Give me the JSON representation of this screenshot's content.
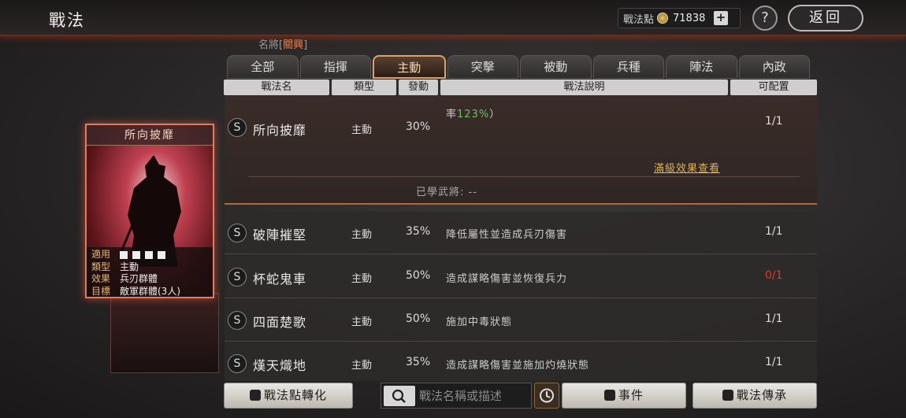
{
  "header": {
    "title": "戰法",
    "points_label": "戰法點",
    "points_value": "71838",
    "plus": "+",
    "help": "?",
    "back": "返回"
  },
  "general_label": {
    "prefix": "名將[",
    "name": "關興",
    "suffix": "]"
  },
  "tabs": [
    "全部",
    "指揮",
    "主動",
    "突擊",
    "被動",
    "兵種",
    "陣法",
    "內政"
  ],
  "active_tab": "主動",
  "columns": {
    "name": "戰法名",
    "type": "類型",
    "trigger": "發動",
    "desc": "戰法說明",
    "config": "可配置"
  },
  "expanded": {
    "badge": "S",
    "name": "所向披靡",
    "type": "主動",
    "rate": "30%",
    "desc_prefix": "率",
    "desc_pct": "123%",
    "desc_suffix": "）",
    "config": "1/1",
    "full_effect": "滿級效果查看",
    "learned": "已學武將: --"
  },
  "rows": [
    {
      "badge": "S",
      "name": "破陣摧堅",
      "type": "主動",
      "rate": "35%",
      "desc": "降低屬性並造成兵刃傷害",
      "config": "1/1",
      "config_color": "normal"
    },
    {
      "badge": "S",
      "name": "杯蛇鬼車",
      "type": "主動",
      "rate": "50%",
      "desc": "造成謀略傷害並恢復兵力",
      "config": "0/1",
      "config_color": "red"
    },
    {
      "badge": "S",
      "name": "四面楚歌",
      "type": "主動",
      "rate": "50%",
      "desc": "施加中毒狀態",
      "config": "1/1",
      "config_color": "normal"
    },
    {
      "badge": "S",
      "name": "熯天熾地",
      "type": "主動",
      "rate": "35%",
      "desc": "造成謀略傷害並施加灼燒狀態",
      "config": "1/1",
      "config_color": "normal"
    }
  ],
  "card": {
    "title": "所向披靡",
    "apply_key": "適用",
    "type_key": "類型",
    "type_val": "主動",
    "effect_key": "效果",
    "effect_val": "兵刃群體",
    "target_key": "目標",
    "target_val": "敵軍群體(3人)"
  },
  "bottom": {
    "convert": "戰法點轉化",
    "search_placeholder": "戰法名稱或描述",
    "events": "事件",
    "inherit": "戰法傳承"
  },
  "colors": {
    "accent": "#d9a26a",
    "red": "#d93a2a",
    "green": "#6fc26a"
  }
}
